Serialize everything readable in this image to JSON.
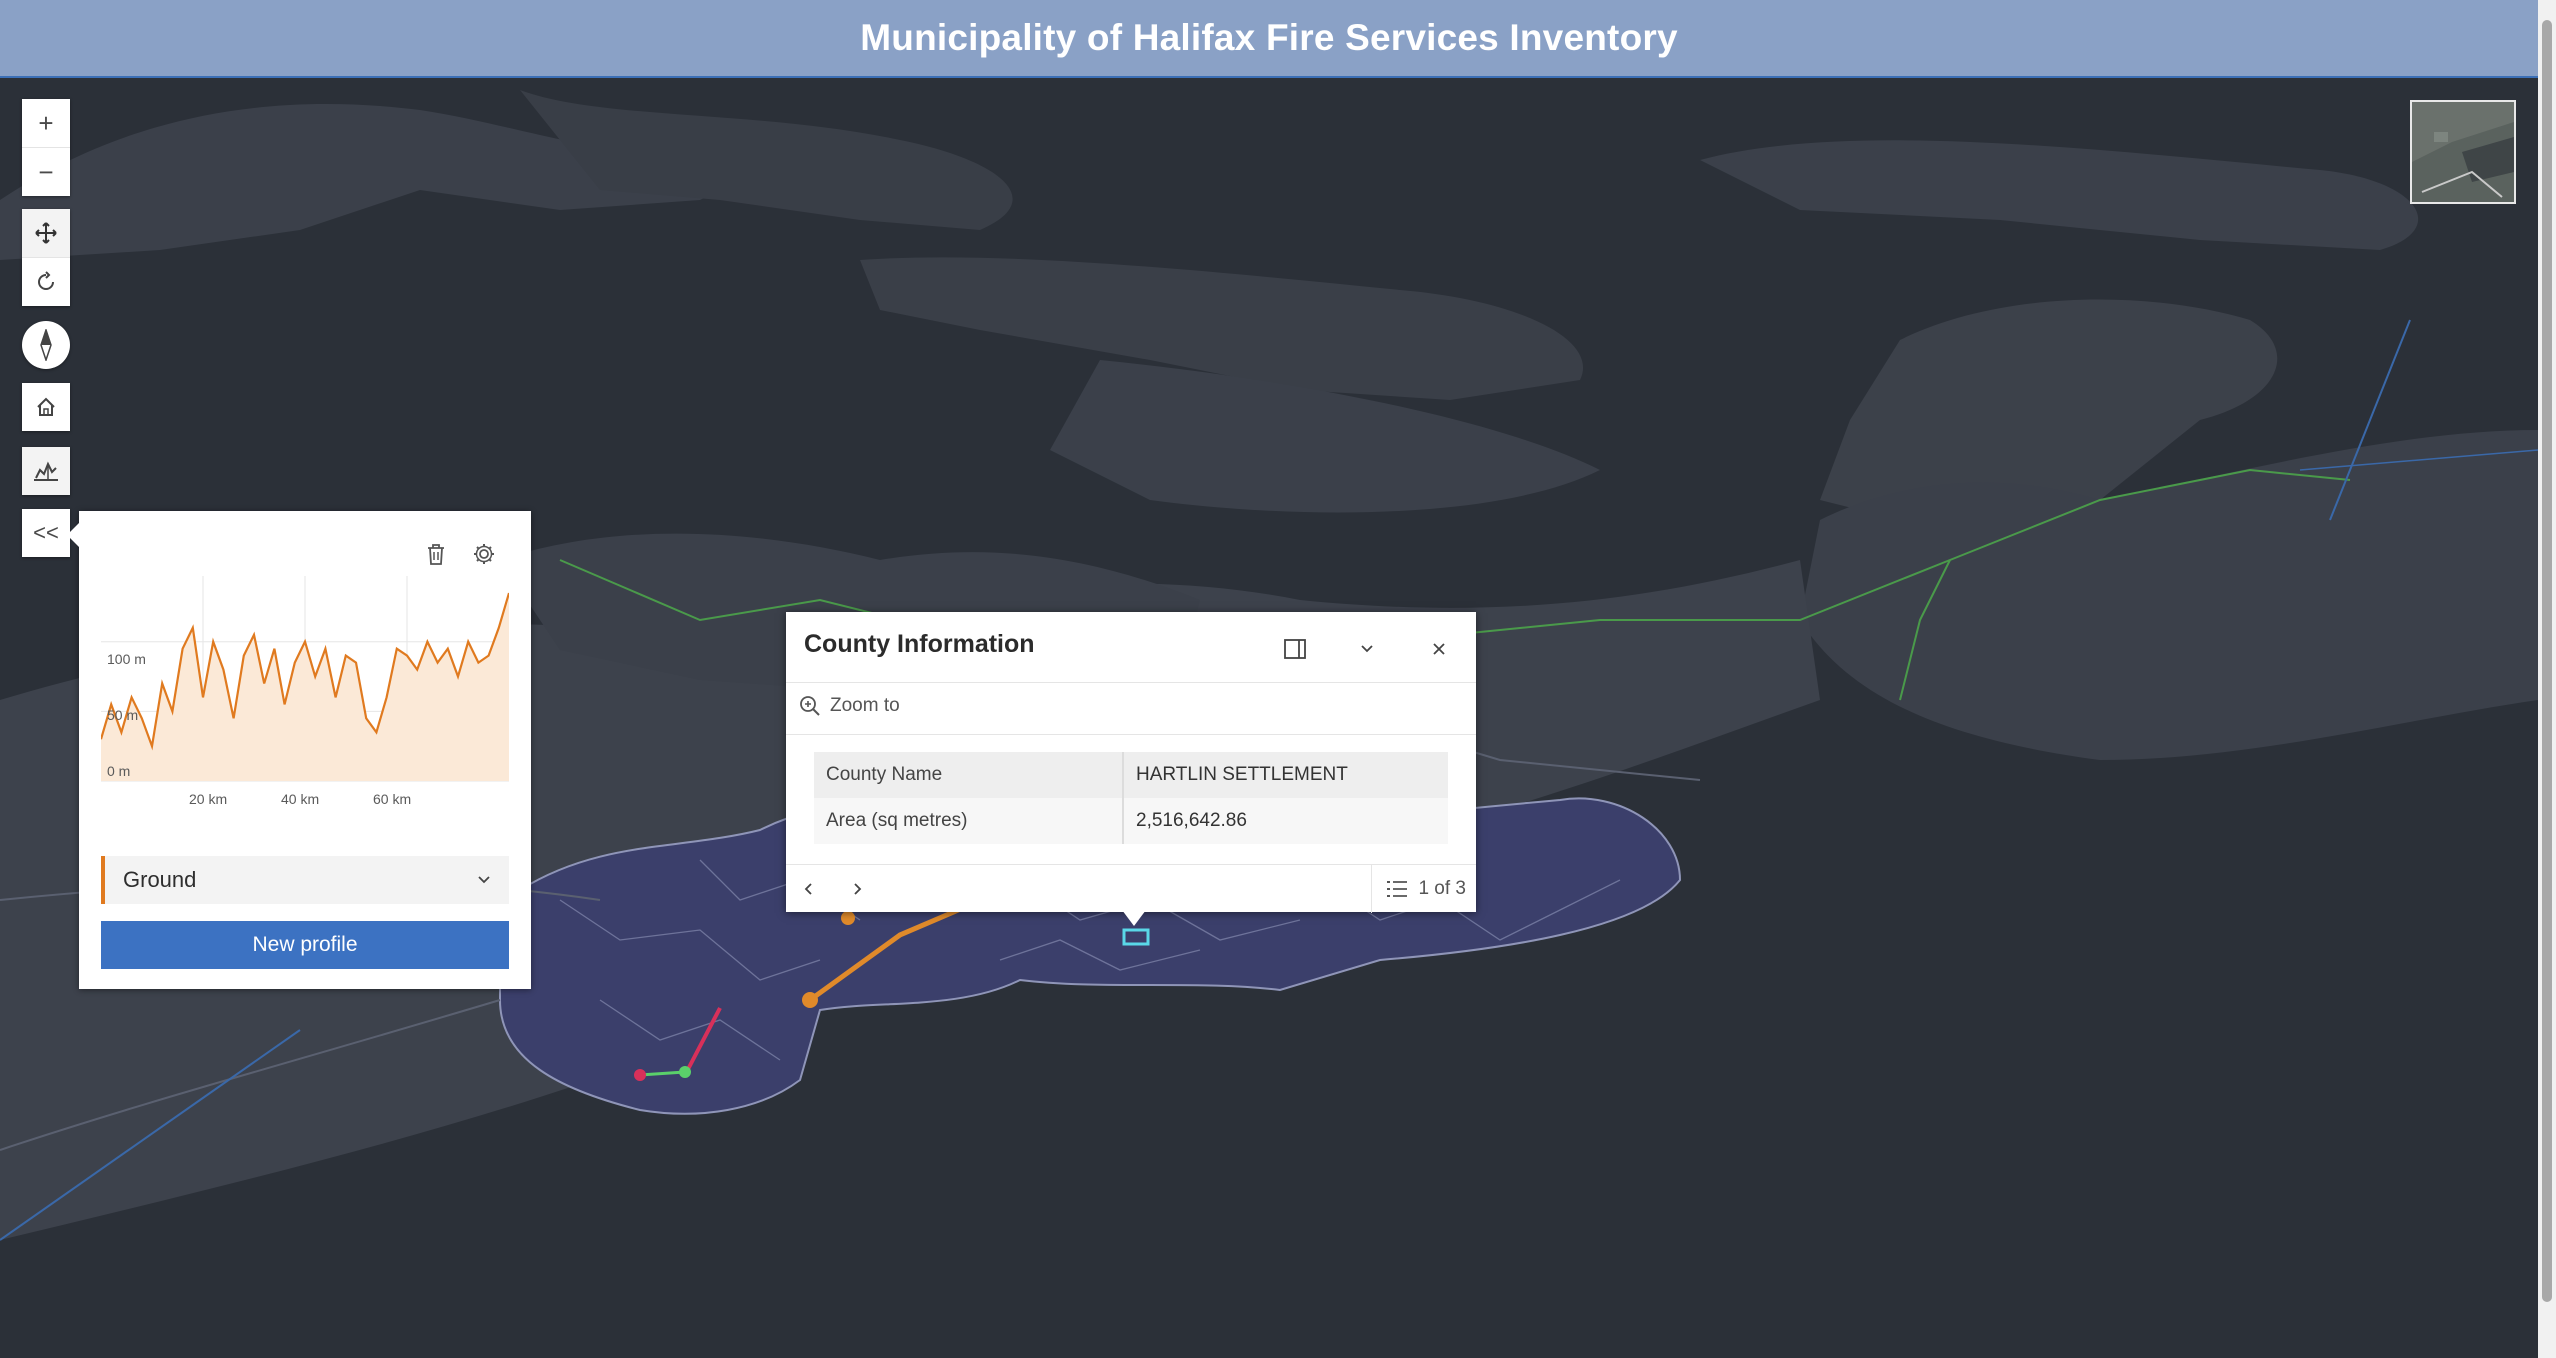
{
  "app": {
    "title": "Municipality of Halifax Fire Services Inventory"
  },
  "toolbar": {
    "zoom_in": "+",
    "zoom_out": "−",
    "collapse": "<<"
  },
  "profile": {
    "chart": {
      "y_ticks": [
        "100 m",
        "50 m",
        "0 m"
      ],
      "x_ticks": [
        "20 km",
        "40 km",
        "60 km"
      ]
    },
    "select_value": "Ground",
    "new_profile_label": "New profile"
  },
  "popup": {
    "title": "County Information",
    "zoom_to": "Zoom to",
    "rows": [
      {
        "key": "County Name",
        "value": "HARTLIN SETTLEMENT"
      },
      {
        "key": "Area (sq metres)",
        "value": "2,516,642.86"
      }
    ],
    "pagination": "1 of 3"
  },
  "chart_data": {
    "type": "area",
    "xlabel": "",
    "ylabel": "",
    "xlim": [
      0,
      80
    ],
    "ylim": [
      0,
      140
    ],
    "x_ticks": [
      "20 km",
      "40 km",
      "60 km"
    ],
    "y_ticks": [
      "0 m",
      "50 m",
      "100 m"
    ],
    "series": [
      {
        "x": [
          0,
          2,
          4,
          6,
          8,
          10,
          12,
          14,
          16,
          18,
          20,
          22,
          24,
          26,
          28,
          30,
          32,
          34,
          36,
          38,
          40,
          42,
          44,
          46,
          48,
          50,
          52,
          54,
          56,
          58,
          60,
          62,
          64,
          66,
          68,
          70,
          72,
          74,
          76,
          78,
          80
        ],
        "y": [
          30,
          55,
          35,
          60,
          45,
          25,
          70,
          50,
          95,
          110,
          60,
          100,
          80,
          45,
          90,
          105,
          70,
          95,
          55,
          85,
          100,
          75,
          95,
          60,
          90,
          85,
          45,
          35,
          60,
          95,
          90,
          80,
          100,
          85,
          95,
          75,
          100,
          85,
          90,
          110,
          135
        ]
      }
    ]
  },
  "colors": {
    "header_bg": "#8aa1c6",
    "accent_orange": "#e07a1f",
    "button_blue": "#3c72c2",
    "map_water": "#2b3038",
    "map_land": "#3b404a",
    "county_fill": "#3b3f6b"
  }
}
